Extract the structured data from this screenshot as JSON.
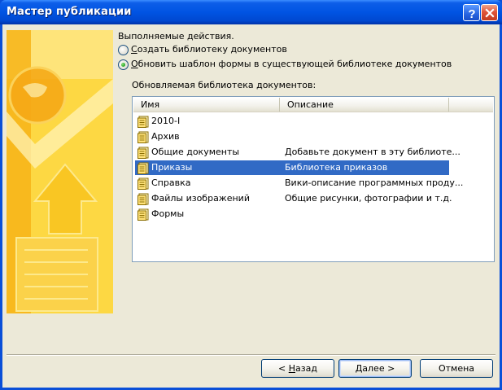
{
  "window": {
    "title": "Мастер публикации",
    "help_label": "?",
    "close_label": "×"
  },
  "actions": {
    "label": "Выполняемые действия.",
    "option_create": {
      "accel": "С",
      "text": "оздать библиотеку документов",
      "selected": false
    },
    "option_update": {
      "accel": "О",
      "text": "бновить шаблон формы в существующей библиотеке документов",
      "selected": true
    }
  },
  "library": {
    "label": "Обновляемая библиотека документов:",
    "columns": [
      "Имя",
      "Описание"
    ],
    "rows": [
      {
        "name": "2010-I",
        "description": ""
      },
      {
        "name": "Архив",
        "description": ""
      },
      {
        "name": "Общие документы",
        "description": "Добавьте документ в эту библиоте..."
      },
      {
        "name": "Приказы",
        "description": "Библиотека приказов",
        "selected": true
      },
      {
        "name": "Справка",
        "description": "Вики-описание программных проду..."
      },
      {
        "name": "Файлы изображений",
        "description": "Общие рисунки, фотографии и т.д."
      },
      {
        "name": "Формы",
        "description": ""
      }
    ],
    "row_icon": "document-library-icon"
  },
  "buttons": {
    "back_prefix": "< ",
    "back_accel": "Н",
    "back_rest": "азад",
    "next_accel": "Д",
    "next_rest": "алее >",
    "cancel": "Отмена"
  },
  "colors": {
    "titlebar": "#0054e3",
    "selection": "#316ac5",
    "dialog": "#ece9d8",
    "banner": "#fdd843"
  }
}
